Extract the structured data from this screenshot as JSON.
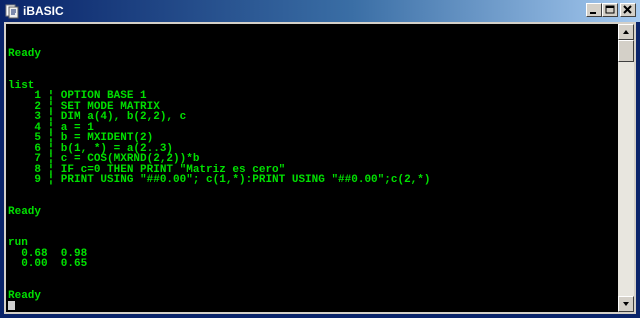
{
  "window": {
    "title": "iBASIC",
    "title_bar_color": "#0a246a"
  },
  "console": {
    "text_color": "#00e000",
    "background": "#000000",
    "lines": [
      "",
      "",
      "Ready",
      "",
      "",
      "list",
      "    1 ¦ OPTION BASE 1",
      "    2 ¦ SET MODE MATRIX",
      "    3 ¦ DIM a(4), b(2,2), c",
      "    4 ¦ a = 1",
      "    5 ¦ b = MXIDENT(2)",
      "    6 ¦ b(1, *) = a(2..3)",
      "    7 ¦ c = COS(MXRND(2,2))*b",
      "    8 ¦ IF c=0 THEN PRINT \"Matriz es cero\"",
      "    9 ¦ PRINT USING \"##0.00\"; c(1,*):PRINT USING \"##0.00\";c(2,*)",
      "",
      "",
      "Ready",
      "",
      "",
      "run",
      "  0.68  0.98",
      "  0.00  0.65",
      "",
      "",
      "Ready",
      ""
    ]
  },
  "icons": {
    "app": "ibasic-app-icon",
    "minimize": "minimize-icon",
    "maximize": "maximize-icon",
    "close": "close-icon",
    "scroll_up": "arrow-up-icon",
    "scroll_down": "arrow-down-icon"
  }
}
